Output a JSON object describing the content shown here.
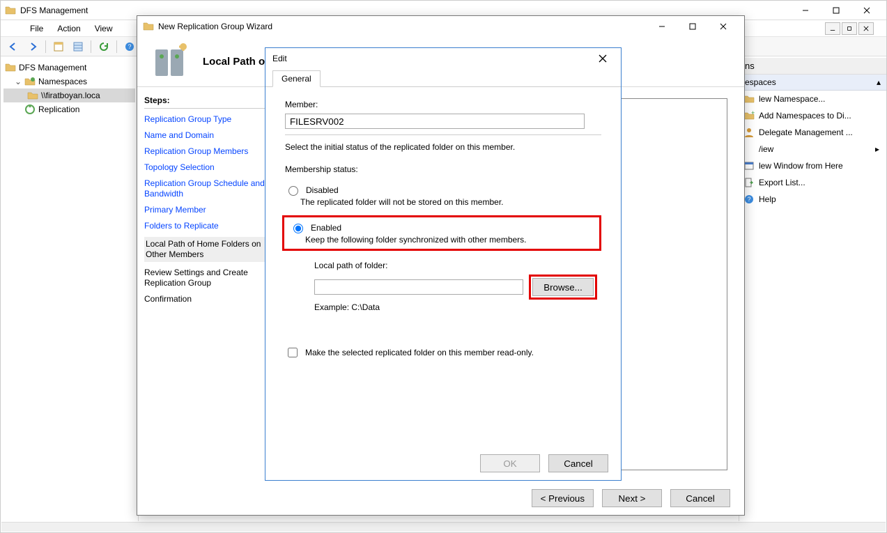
{
  "main": {
    "title": "DFS Management",
    "menu": {
      "file": "File",
      "action": "Action",
      "view": "View"
    },
    "tree": {
      "root": "DFS Management",
      "namespaces": "Namespaces",
      "namespace1": "\\\\firatboyan.loca",
      "replication": "Replication"
    }
  },
  "actions": {
    "header": "ns",
    "group": "espaces",
    "items": [
      "lew Namespace...",
      "Add Namespaces to Di...",
      "Delegate Management ...",
      "/iew",
      "lew Window from Here",
      "Export List...",
      "Help"
    ]
  },
  "wizard": {
    "title": "New Replication Group Wizard",
    "header_title": "Local Path o",
    "steps_label": "Steps:",
    "steps": [
      "Replication Group Type",
      "Name and Domain",
      "Replication Group Members",
      "Topology Selection",
      "Replication Group Schedule and Bandwidth",
      "Primary Member",
      "Folders to Replicate",
      "Local Path of Home Folders on Other Members",
      "Review Settings and Create Replication Group",
      "Confirmation"
    ],
    "footer": {
      "prev": "< Previous",
      "next": "Next >",
      "cancel": "Cancel"
    }
  },
  "edit": {
    "title": "Edit",
    "tab": "General",
    "member_label": "Member:",
    "member_value": "FILESRV002",
    "description": "Select the initial status of the replicated folder on this member.",
    "status_label": "Membership status:",
    "disabled_label": "Disabled",
    "disabled_desc": "The replicated folder will not be stored on this member.",
    "enabled_label": "Enabled",
    "enabled_desc": "Keep the following folder synchronized with other members.",
    "path_label": "Local path of folder:",
    "path_value": "",
    "browse": "Browse...",
    "example": "Example: C:\\Data",
    "readonly_label": "Make the selected replicated folder on this member read-only.",
    "ok": "OK",
    "cancel": "Cancel"
  }
}
